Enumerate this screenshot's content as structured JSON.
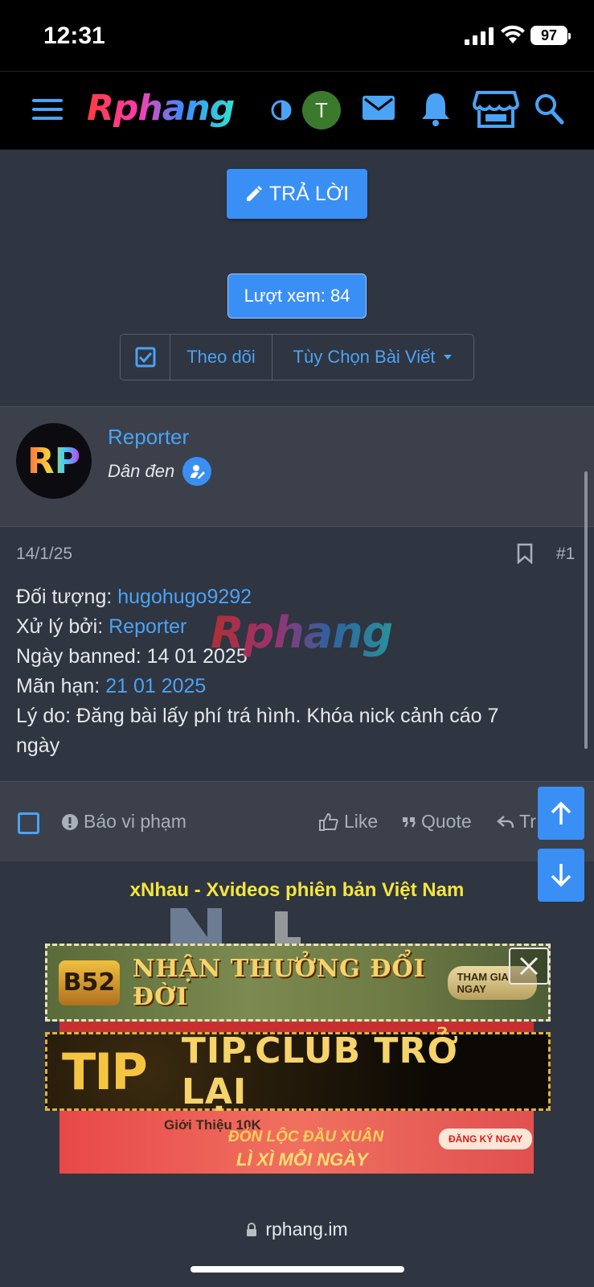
{
  "status": {
    "time": "12:31",
    "battery": "97"
  },
  "header": {
    "logo": "Rphang"
  },
  "user_avatar_letter": "T",
  "actions": {
    "reply": "TRẢ LỜI",
    "views": "Lượt xem: 84",
    "follow": "Theo dõi",
    "post_options": "Tùy Chọn Bài Viết"
  },
  "post": {
    "author": "Reporter",
    "author_avatar": "RP",
    "author_title": "Dân đen",
    "date": "14/1/25",
    "number": "#1",
    "watermark": "Rphang",
    "lines": [
      {
        "label": "Đối tượng: ",
        "value": "hugohugo9292"
      },
      {
        "label": "Xử lý bởi: ",
        "value": "Reporter"
      },
      {
        "label": "Ngày banned: 14 01 2025",
        "value": ""
      },
      {
        "label": "Mãn hạn: ",
        "value": "21 01 2025"
      }
    ],
    "reason_line1": "Lý do: Đăng bài lấy phí trá hình. Khóa nick cảnh cáo 7",
    "reason_line2": "ngày",
    "footer": {
      "report": "Báo vi phạm",
      "like": "Like",
      "quote": "Quote",
      "reply": "Tr"
    }
  },
  "ads": {
    "title": "xNhau - Xvideos phiên bản Việt Nam",
    "b52_logo": "B52",
    "b52_text": "NHẬN THƯỞNG ĐỔI ĐỜI",
    "b52_cta": "THAM GIA NGAY",
    "tip_logo": "TIP",
    "tip_text": "TIP.CLUB TRỞ LẠI",
    "red_line1": "Giới Thiệu",
    "red_badge": "10K",
    "red_line2": "ĐÓN LỘC ĐẦU XUÂN",
    "red_line3": "LÌ XÌ MỖI NGÀY",
    "red_cta": "ĐĂNG KÝ NGAY"
  },
  "browser": {
    "url": "rphang.im"
  },
  "colors": {
    "accent": "#3a8ff5",
    "link": "#4aa3f5",
    "bg": "#2f3541",
    "panel": "#3b404b"
  }
}
